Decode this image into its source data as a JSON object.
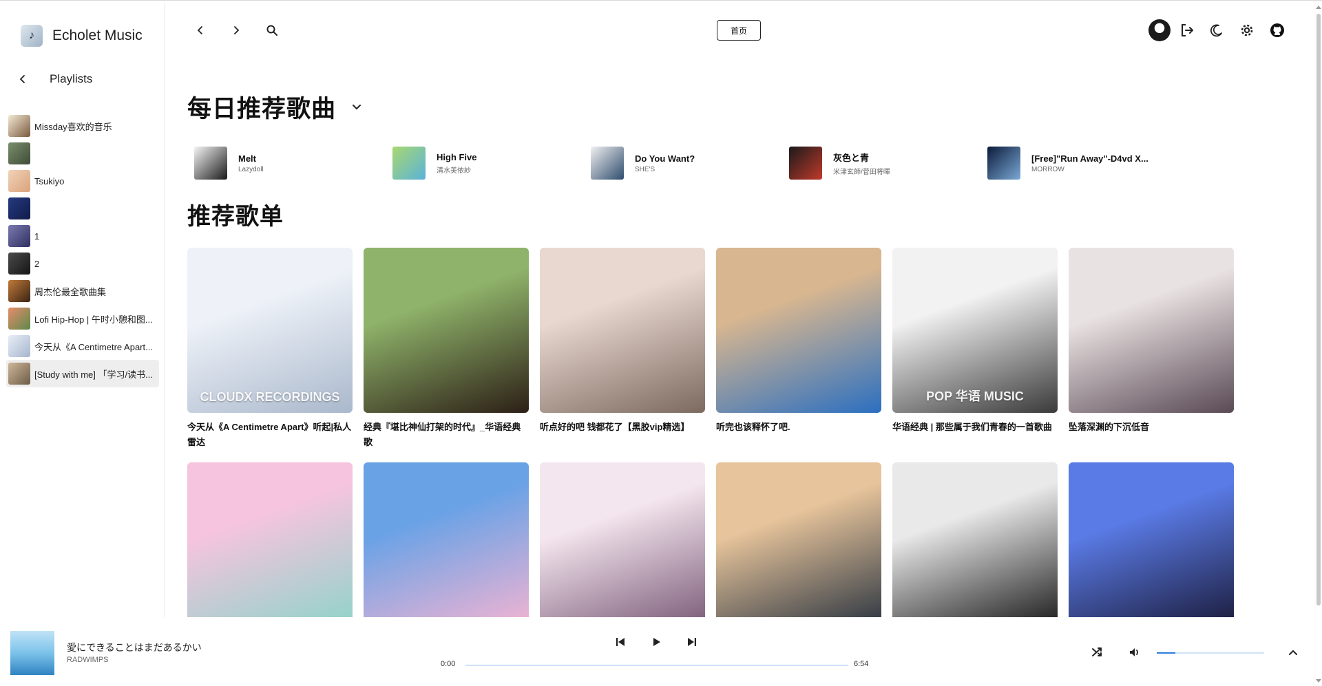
{
  "app": {
    "title": "Echolet Music"
  },
  "sidebar": {
    "header": "Playlists",
    "items": [
      {
        "label": "Missday喜欢的音乐",
        "color_a": "#f4ead6",
        "color_b": "#7a5a3c",
        "active": false
      },
      {
        "label": "",
        "color_a": "#7a8e6c",
        "color_b": "#3e4c36",
        "active": false
      },
      {
        "label": "Tsukiyo",
        "color_a": "#f2d2b9",
        "color_b": "#d9a37b",
        "active": false
      },
      {
        "label": "",
        "color_a": "#253a80",
        "color_b": "#111b4a",
        "active": false
      },
      {
        "label": "1",
        "color_a": "#7a7ab0",
        "color_b": "#2f2f60",
        "active": false
      },
      {
        "label": "2",
        "color_a": "#4b4b4b",
        "color_b": "#151515",
        "active": false
      },
      {
        "label": "周杰伦最全歌曲集",
        "color_a": "#c17a3a",
        "color_b": "#3a2414",
        "active": false
      },
      {
        "label": "Lofi Hip-Hop | 午时小憩和图...",
        "color_a": "#e78c6c",
        "color_b": "#5c8a4a",
        "active": false
      },
      {
        "label": "今天从《A Centimetre Apart...",
        "color_a": "#e9eef6",
        "color_b": "#a6b6cf",
        "active": false
      },
      {
        "label": "[Study with me] 「学习/读书...",
        "color_a": "#cdb79a",
        "color_b": "#6d5c45",
        "active": true
      }
    ]
  },
  "topbar": {
    "home_label": "首页",
    "icons": [
      "back-arrow-icon",
      "forward-arrow-icon",
      "search-icon",
      "logout-icon",
      "moon-icon",
      "gear-icon",
      "github-icon"
    ]
  },
  "daily": {
    "title": "每日推荐歌曲",
    "songs": [
      {
        "title": "Melt",
        "artist": "Lazydoll",
        "color_a": "#f5f5f5",
        "color_b": "#1a1a1a"
      },
      {
        "title": "High Five",
        "artist": "清水美依紗",
        "color_a": "#a9d870",
        "color_b": "#5ab2d9"
      },
      {
        "title": "Do You Want?",
        "artist": "SHE'S",
        "color_a": "#f0f0f0",
        "color_b": "#2f4c6e"
      },
      {
        "title": "灰色と青",
        "artist": "米津玄師/菅田将暉",
        "color_a": "#1a1a1a",
        "color_b": "#c0392b"
      },
      {
        "title": "[Free]\"Run Away\"-D4vd X...",
        "artist": "MORROW",
        "color_a": "#0b1a3a",
        "color_b": "#7aa9d6"
      }
    ]
  },
  "recommended": {
    "title": "推荐歌单",
    "playlists": [
      {
        "title": "今天从《A Centimetre Apart》听起|私人雷达",
        "color_a": "#eef2f8",
        "color_b": "#aab8cc",
        "overlay": "CLOUDX RECORDINGS"
      },
      {
        "title": "经典『堪比神仙打架的时代』_华语经典歌",
        "color_a": "#8fb36a",
        "color_b": "#2c1f16",
        "overlay": ""
      },
      {
        "title": "听点好的吧 钱都花了【黑胶vip精选】",
        "color_a": "#e9d8cf",
        "color_b": "#7c6a60",
        "overlay": ""
      },
      {
        "title": "听完也该释怀了吧.",
        "color_a": "#d7b690",
        "color_b": "#2b6fc0",
        "overlay": ""
      },
      {
        "title": "华语经典 | 那些属于我们青春的一首歌曲",
        "color_a": "#f2f2f2",
        "color_b": "#3a3a3a",
        "overlay": "POP 华语 MUSIC"
      },
      {
        "title": "坠落深渊的下沉低音",
        "color_a": "#e9e2e2",
        "color_b": "#5a4a55",
        "overlay": ""
      },
      {
        "title": "",
        "color_a": "#f6c4de",
        "color_b": "#8fd3c9",
        "overlay": ""
      },
      {
        "title": "",
        "color_a": "#6aa2e6",
        "color_b": "#f3b4d2",
        "overlay": ""
      },
      {
        "title": "",
        "color_a": "#f4e6ee",
        "color_b": "#7a5a78",
        "overlay": ""
      },
      {
        "title": "",
        "color_a": "#e7c49b",
        "color_b": "#2a3440",
        "overlay": ""
      },
      {
        "title": "",
        "color_a": "#e9e9e9",
        "color_b": "#1a1a1a",
        "overlay": ""
      },
      {
        "title": "",
        "color_a": "#5a7be6",
        "color_b": "#1b1b3a",
        "overlay": ""
      }
    ]
  },
  "player": {
    "title": "愛にできることはまだあるかい",
    "artist": "RADWIMPS",
    "current_time": "0:00",
    "total_time": "6:54",
    "progress": 0,
    "volume": 0.17
  },
  "colors": {
    "accent": "#2e7ddb",
    "track": "#cfe2f8"
  }
}
